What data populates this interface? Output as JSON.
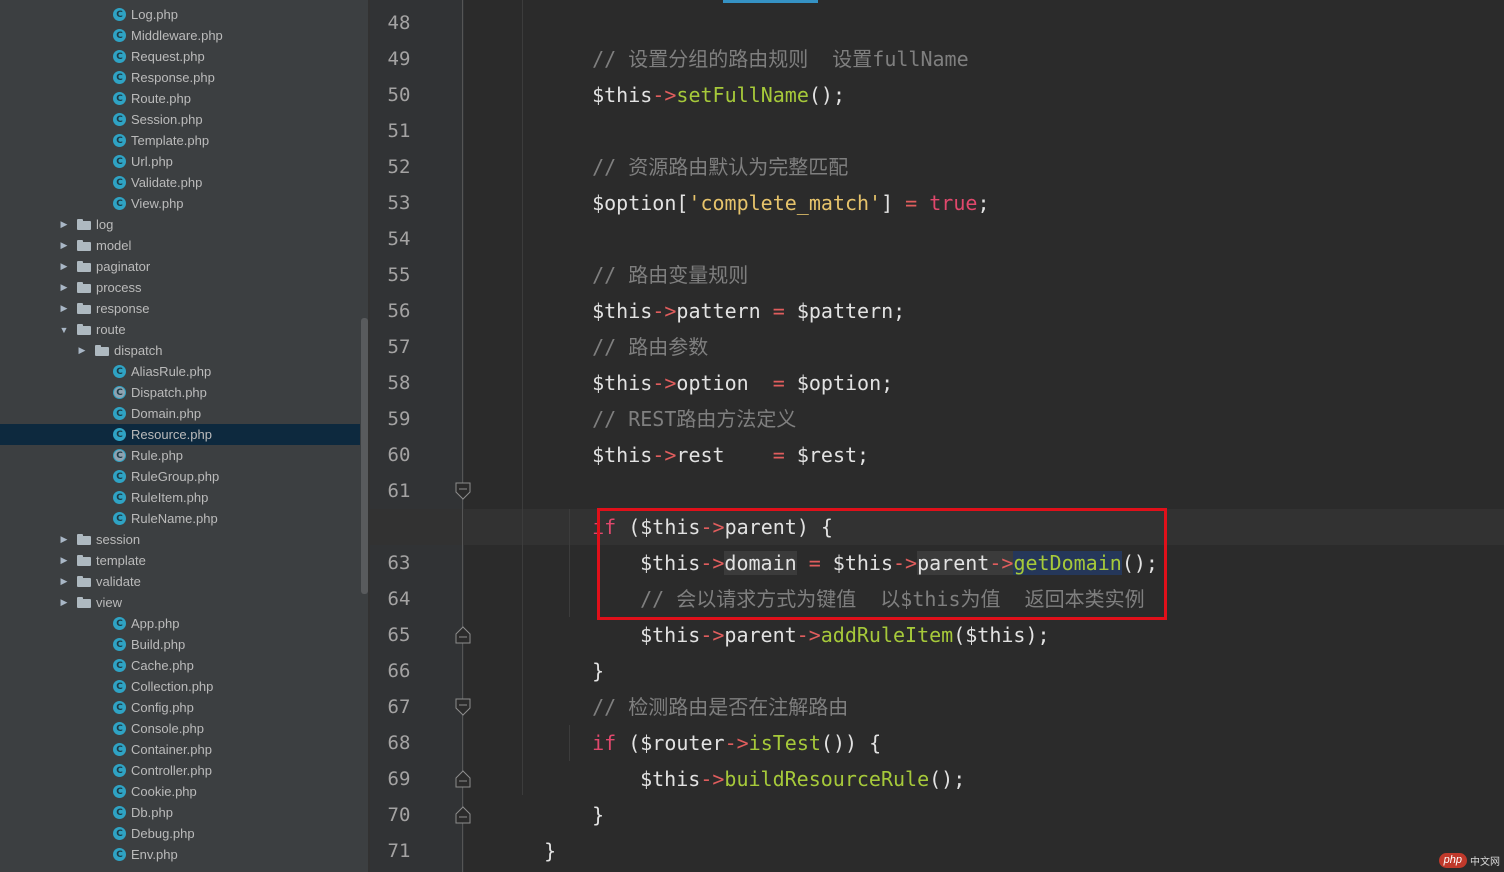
{
  "sidebar": {
    "items": [
      {
        "label": "Log.php",
        "type": "class"
      },
      {
        "label": "Middleware.php",
        "type": "class"
      },
      {
        "label": "Request.php",
        "type": "class"
      },
      {
        "label": "Response.php",
        "type": "class"
      },
      {
        "label": "Route.php",
        "type": "class"
      },
      {
        "label": "Session.php",
        "type": "class"
      },
      {
        "label": "Template.php",
        "type": "class"
      },
      {
        "label": "Url.php",
        "type": "class"
      },
      {
        "label": "Validate.php",
        "type": "class"
      },
      {
        "label": "View.php",
        "type": "class"
      },
      {
        "label": "log",
        "type": "folder",
        "expanded": false
      },
      {
        "label": "model",
        "type": "folder",
        "expanded": false
      },
      {
        "label": "paginator",
        "type": "folder",
        "expanded": false
      },
      {
        "label": "process",
        "type": "folder",
        "expanded": false
      },
      {
        "label": "response",
        "type": "folder",
        "expanded": false
      },
      {
        "label": "route",
        "type": "folder",
        "expanded": true
      },
      {
        "label": "dispatch",
        "type": "folder",
        "expanded": false
      },
      {
        "label": "AliasRule.php",
        "type": "class"
      },
      {
        "label": "Dispatch.php",
        "type": "abstract-class"
      },
      {
        "label": "Domain.php",
        "type": "class"
      },
      {
        "label": "Resource.php",
        "type": "class",
        "selected": true
      },
      {
        "label": "Rule.php",
        "type": "abstract-class"
      },
      {
        "label": "RuleGroup.php",
        "type": "class"
      },
      {
        "label": "RuleItem.php",
        "type": "class"
      },
      {
        "label": "RuleName.php",
        "type": "class"
      },
      {
        "label": "session",
        "type": "folder",
        "expanded": false
      },
      {
        "label": "template",
        "type": "folder",
        "expanded": false
      },
      {
        "label": "validate",
        "type": "folder",
        "expanded": false
      },
      {
        "label": "view",
        "type": "folder",
        "expanded": false
      },
      {
        "label": "App.php",
        "type": "class"
      },
      {
        "label": "Build.php",
        "type": "class"
      },
      {
        "label": "Cache.php",
        "type": "class"
      },
      {
        "label": "Collection.php",
        "type": "class"
      },
      {
        "label": "Config.php",
        "type": "class"
      },
      {
        "label": "Console.php",
        "type": "class"
      },
      {
        "label": "Container.php",
        "type": "class"
      },
      {
        "label": "Controller.php",
        "type": "class"
      },
      {
        "label": "Cookie.php",
        "type": "class"
      },
      {
        "label": "Db.php",
        "type": "class"
      },
      {
        "label": "Debug.php",
        "type": "class"
      },
      {
        "label": "Env.php",
        "type": "class"
      }
    ]
  },
  "editor": {
    "line_numbers": [
      "48",
      "49",
      "50",
      "51",
      "52",
      "53",
      "54",
      "55",
      "56",
      "57",
      "58",
      "59",
      "60",
      "61",
      "62",
      "63",
      "64",
      "65",
      "66",
      "67",
      "68",
      "69",
      "70",
      "71"
    ],
    "current_line": "62",
    "lines": {
      "l48": {
        "c1": "// 设置分组的路由规则  设置fullName"
      },
      "l49": {
        "v1": "$this",
        "o1": "->",
        "f1": "setFullName",
        "p1": "();"
      },
      "l51": {
        "c1": "// 资源路由默认为完整匹配"
      },
      "l52": {
        "v1": "$option[",
        "s1": "'complete_match'",
        "p1": "] ",
        "o1": "=",
        "sp": " ",
        "k1": "true",
        "p2": ";"
      },
      "l54": {
        "c1": "// 路由变量规则"
      },
      "l55": {
        "v1": "$this",
        "o1": "->",
        "v2": "pattern ",
        "o2": "=",
        "v3": " $pattern;"
      },
      "l56": {
        "c1": "// 路由参数"
      },
      "l57": {
        "v1": "$this",
        "o1": "->",
        "v2": "option  ",
        "o2": "=",
        "v3": " $option;"
      },
      "l58": {
        "c1": "// REST路由方法定义"
      },
      "l59": {
        "v1": "$this",
        "o1": "->",
        "v2": "rest    ",
        "o2": "=",
        "v3": " $rest;"
      },
      "l61": {
        "k1": "if",
        "v1": " ($this",
        "o1": "->",
        "v2": "parent) {"
      },
      "l62": {
        "v1": "$this",
        "o1": "->",
        "v2": "domain",
        "sp": " ",
        "o2": "=",
        "v3": " $this",
        "o3": "->",
        "v4": "parent",
        "o4": "->",
        "f1": "getDomain",
        "p1": "();"
      },
      "l63": {
        "c1": "// 会以请求方式为键值  以$this为值  返回本类实例"
      },
      "l64": {
        "v1": "$this",
        "o1": "->",
        "v2": "parent",
        "o2": "->",
        "f1": "addRuleItem",
        "p1": "($this);"
      },
      "l65": {
        "p1": "}"
      },
      "l66": {
        "c1": "// 检测路由是否在注解路由"
      },
      "l67": {
        "k1": "if",
        "v1": " ($router",
        "o1": "->",
        "f1": "isTest",
        "p1": "()) {"
      },
      "l68": {
        "v1": "$this",
        "o1": "->",
        "f1": "buildResourceRule",
        "p1": "();"
      },
      "l69": {
        "p1": "}"
      },
      "l70": {
        "p1": "}"
      }
    }
  },
  "colors": {
    "highlight_box": "#e0101a",
    "sidebar_bg": "#3c3f41",
    "editor_bg": "#2b2b2b",
    "selected_row": "#0d293e"
  },
  "watermark": {
    "logo": "php",
    "text": "中文网"
  }
}
